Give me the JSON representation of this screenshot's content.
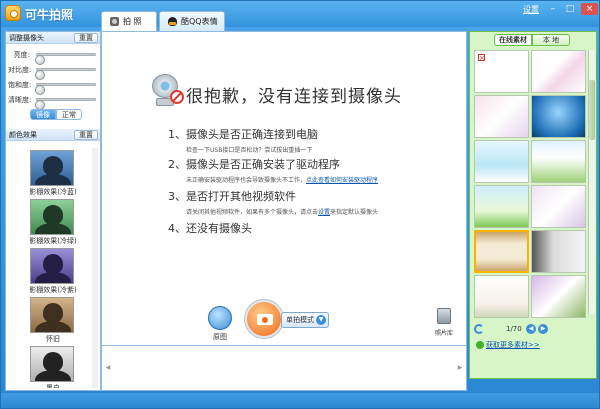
{
  "app": {
    "title": "可牛拍照"
  },
  "titlebar": {
    "settings_label": "设置",
    "min_label": "–",
    "max_label": "□",
    "close_label": "×"
  },
  "tabs": [
    {
      "label": "拍 照",
      "icon": "camera-icon"
    },
    {
      "label": "酷QQ表情",
      "icon": "qq-penguin-icon"
    }
  ],
  "adjust": {
    "title": "调整摄像头",
    "reset_label": "重置",
    "sliders": [
      {
        "label": "亮度:",
        "value": 0.05
      },
      {
        "label": "对比度:",
        "value": 0.05
      },
      {
        "label": "饱和度:",
        "value": 0.05
      },
      {
        "label": "清晰度:",
        "value": 0.05
      }
    ],
    "mode_mirror": "镜像",
    "mode_normal": "正常"
  },
  "effects": {
    "title": "颜色效果",
    "reset_label": "重置",
    "items": [
      {
        "label": "影棚效果(冷蓝)",
        "color": "#2f5f93"
      },
      {
        "label": "影棚效果(冷绿)",
        "color": "#3f8a52"
      },
      {
        "label": "影棚效果(冷紫)",
        "color": "#4a3f8a"
      },
      {
        "label": "怀旧",
        "color": "#8a6a44"
      },
      {
        "label": "黑白",
        "color": "#666666"
      }
    ]
  },
  "main": {
    "error_title": "很抱歉，没有连接到摄像头",
    "steps": [
      {
        "title": "1、摄像头是否正确连接到电脑",
        "desc": "检查一下USB接口是否松动？尝试拔出重插一下",
        "link": ""
      },
      {
        "title": "2、摄像头是否正确安装了驱动程序",
        "desc": "未正确安装驱动程序也会导致摄像头不工作，",
        "link": "点此查看如何安装驱动程序"
      },
      {
        "title": "3、是否打开其他视频软件",
        "desc": "请关闭其他视频软件，如果有多个摄像头，请点击",
        "link": "设置",
        "desc_after": "来指定默认摄像头"
      },
      {
        "title": "4、还没有摄像头",
        "desc": "",
        "link": ""
      }
    ]
  },
  "toolbar": {
    "original_label": "原图",
    "shoot_mode": "单拍模式",
    "album_label": "照片库"
  },
  "materials": {
    "tab_online": "在线素材",
    "tab_local": "本 地",
    "page": "1/70",
    "more_link": "获取更多素材>>"
  },
  "colors": {
    "accent": "#2b86d2",
    "panel_green": "#d8f5c8",
    "error_red": "#e23b2e"
  }
}
